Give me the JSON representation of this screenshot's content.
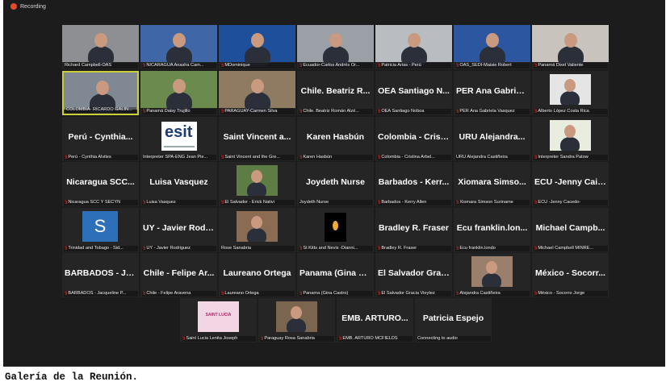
{
  "recording": {
    "label": "Recording"
  },
  "caption": "Galería de la Reunión.",
  "rows": [
    [
      {
        "name": "",
        "label": "Richard Campbell-OAS",
        "mic": false,
        "type": "video",
        "bg": "#8d8f93"
      },
      {
        "name": "",
        "label": "NICARAGUA Anasha Cam...",
        "mic": true,
        "type": "video",
        "bg": "#3f67a8"
      },
      {
        "name": "",
        "label": "MDominique",
        "mic": true,
        "type": "video",
        "bg": "#1d4f9a"
      },
      {
        "name": "",
        "label": "Ecuador-Carlos Andrés Or...",
        "mic": true,
        "type": "video",
        "bg": "#9aa0a6"
      },
      {
        "name": "",
        "label": "Patricia Arias - Perú",
        "mic": true,
        "type": "video",
        "bg": "#b9bcc0"
      },
      {
        "name": "",
        "label": "OAS_SEDI-Maisie Robert",
        "mic": true,
        "type": "video",
        "bg": "#2c56a0"
      },
      {
        "name": "",
        "label": "Panamá Dixel Valiente",
        "mic": true,
        "type": "video",
        "bg": "#c9c3bd"
      }
    ],
    [
      {
        "name": "",
        "label": "COLOMBIA- RICARDO GALIN...",
        "mic": false,
        "type": "video",
        "bg": "#7f8893",
        "active": true
      },
      {
        "name": "",
        "label": "Panamá Daisy Trujillo",
        "mic": true,
        "type": "video",
        "bg": "#6a8a4e"
      },
      {
        "name": "",
        "label": "PARAGUAY-Carmen Silva",
        "mic": true,
        "type": "video",
        "bg": "#8e7b62"
      },
      {
        "name": "Chile. Beatriz R...",
        "label": "Chile. Beatriz Román Alzé...",
        "mic": true,
        "type": "text"
      },
      {
        "name": "OEA Santiago N...",
        "label": "OEA Santiago Noboa",
        "mic": true,
        "type": "text"
      },
      {
        "name": "PER Ana Gabriel...",
        "label": "PER Ana Gabriela Vasquez",
        "mic": true,
        "type": "text"
      },
      {
        "name": "",
        "label": "Alberto López Costa Rica",
        "mic": true,
        "type": "thumb",
        "bg": "#e5e5e5"
      }
    ],
    [
      {
        "name": "Perú - Cynthia...",
        "label": "Perú - Cynthia Alvites",
        "mic": true,
        "type": "text"
      },
      {
        "name": "",
        "label": "Interpreter SPA-ENG Jean Pie...",
        "mic": false,
        "type": "esit",
        "logo": "esit"
      },
      {
        "name": "Saint Vincent a...",
        "label": "Saint Vincent and the Gre...",
        "mic": true,
        "type": "text"
      },
      {
        "name": "Karen Hasbún",
        "label": "Karen Hasbún",
        "mic": true,
        "type": "text"
      },
      {
        "name": "Colombia - Crist...",
        "label": "Colombia - Cristina Arbel...",
        "mic": true,
        "type": "text"
      },
      {
        "name": "URU Alejandra...",
        "label": "URU Alejandra Castiñeira",
        "mic": false,
        "type": "text"
      },
      {
        "name": "",
        "label": "Interpreter Sandra Patow",
        "mic": true,
        "type": "thumb",
        "bg": "#e8ede0"
      }
    ],
    [
      {
        "name": "Nicaragua SCC...",
        "label": "Nicaragua SCC Y SECYN",
        "mic": true,
        "type": "text"
      },
      {
        "name": "Luisa Vasquez",
        "label": "Luisa Vasquez",
        "mic": true,
        "type": "text"
      },
      {
        "name": "",
        "label": "El Salvador - Erick Nativi",
        "mic": true,
        "type": "thumb",
        "bg": "#5e7d45"
      },
      {
        "name": "Joydeth Nurse",
        "label": "Joydeth Nurse",
        "mic": false,
        "type": "text"
      },
      {
        "name": "Barbados - Kerr...",
        "label": "Barbados - Kerry Allen",
        "mic": true,
        "type": "text"
      },
      {
        "name": "Xiomara Simso...",
        "label": "Xiomara Simson Suriname",
        "mic": true,
        "type": "text"
      },
      {
        "name": "ECU -Jenny Caic...",
        "label": "ECU -Jenny Cacedo-",
        "mic": true,
        "type": "text"
      }
    ],
    [
      {
        "name": "",
        "label": "Trinidad and Tobago - Sid...",
        "mic": true,
        "type": "avatar",
        "avatar": "S"
      },
      {
        "name": "UY - Javier Rodr...",
        "label": "UY - Javier Rodriguez",
        "mic": true,
        "type": "text"
      },
      {
        "name": "",
        "label": "Rose Sanabria",
        "mic": false,
        "type": "thumb",
        "bg": "#8b6b52"
      },
      {
        "name": "",
        "label": "St Kitts and Nevis -Dianni...",
        "mic": true,
        "type": "candle"
      },
      {
        "name": "Bradley R. Fraser",
        "label": "Bradley R. Fraser",
        "mic": true,
        "type": "text"
      },
      {
        "name": "Ecu franklin.lon...",
        "label": "Ecu franklin.londo",
        "mic": true,
        "type": "text"
      },
      {
        "name": "Michael Campb...",
        "label": "Michael Campbell MINRE...",
        "mic": true,
        "type": "text"
      }
    ],
    [
      {
        "name": "BARBADOS - Ja...",
        "label": "BARBADOS - Jacqueline P...",
        "mic": true,
        "type": "text"
      },
      {
        "name": "Chile - Felipe Ar...",
        "label": "Chile - Felipe Aravena",
        "mic": true,
        "type": "text"
      },
      {
        "name": "Laureano Ortega",
        "label": "Laureano Ortega",
        "mic": true,
        "type": "text"
      },
      {
        "name": "Panama (Gina C...",
        "label": "Panama (Gina Castro)",
        "mic": true,
        "type": "text"
      },
      {
        "name": "El Salvador Grac...",
        "label": "El Salvador Gracia Vieytez",
        "mic": true,
        "type": "text"
      },
      {
        "name": "",
        "label": "Alejandra Castiñeira",
        "mic": true,
        "type": "thumb",
        "bg": "#9a7f6c"
      },
      {
        "name": "México - Socorr...",
        "label": "México - Socorro Jorge",
        "mic": true,
        "type": "text"
      }
    ],
    [
      {
        "name": "",
        "label": "Saint Lucia Lenita Joseph",
        "mic": true,
        "type": "thumb",
        "bg": "#f3d6e4",
        "logo": "SAINT LUCIA"
      },
      {
        "name": "",
        "label": "Paraguay Rosa Sanabria",
        "mic": true,
        "type": "thumb",
        "bg": "#7b654f"
      },
      {
        "name": "EMB. ARTURO...",
        "label": "EMB. ARTURO MCFIELDS",
        "mic": true,
        "type": "text"
      },
      {
        "name": "Patricia Espejo",
        "label": "Connecting to audio",
        "mic": false,
        "type": "text"
      }
    ]
  ]
}
